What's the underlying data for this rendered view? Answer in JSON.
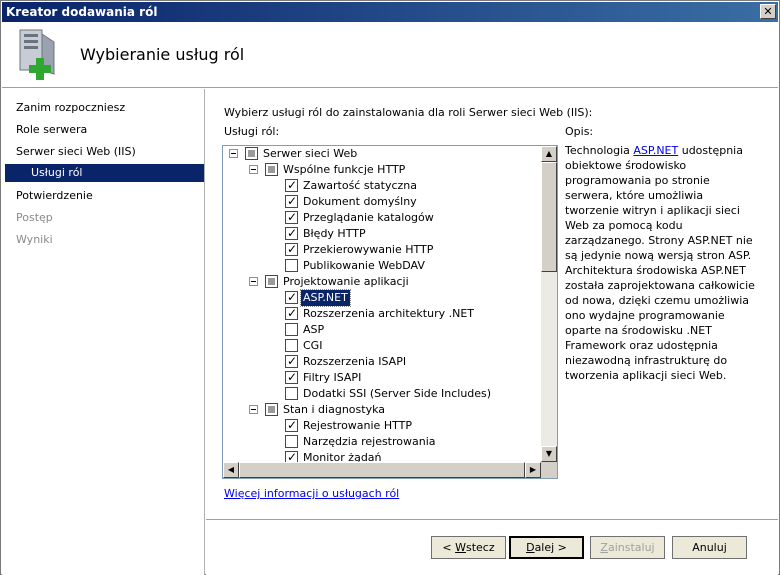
{
  "window": {
    "title": "Kreator dodawania ról",
    "close_glyph": "✕"
  },
  "header": {
    "title": "Wybieranie usług ról",
    "icon": "server-add-icon"
  },
  "nav": {
    "items": [
      {
        "label": "Zanim rozpoczniesz",
        "state": "normal"
      },
      {
        "label": "Role serwera",
        "state": "normal"
      },
      {
        "label": "Serwer sieci Web (IIS)",
        "state": "normal"
      },
      {
        "label": "Usługi ról",
        "state": "selected"
      },
      {
        "label": "Potwierdzenie",
        "state": "normal"
      },
      {
        "label": "Postęp",
        "state": "disabled"
      },
      {
        "label": "Wyniki",
        "state": "disabled"
      }
    ]
  },
  "content": {
    "intro": "Wybierz usługi ról do zainstalowania dla roli Serwer sieci Web (IIS):",
    "services_label": "Usługi ról:",
    "description_label": "Opis:",
    "tree": [
      {
        "label": "Serwer sieci Web",
        "level": 0,
        "expander": true,
        "state": "partial"
      },
      {
        "label": "Wspólne funkcje HTTP",
        "level": 1,
        "expander": true,
        "state": "partial"
      },
      {
        "label": "Zawartość statyczna",
        "level": 2,
        "state": "checked"
      },
      {
        "label": "Dokument domyślny",
        "level": 2,
        "state": "checked"
      },
      {
        "label": "Przeglądanie katalogów",
        "level": 2,
        "state": "checked"
      },
      {
        "label": "Błędy HTTP",
        "level": 2,
        "state": "checked"
      },
      {
        "label": "Przekierowywanie HTTP",
        "level": 2,
        "state": "checked"
      },
      {
        "label": "Publikowanie WebDAV",
        "level": 2,
        "state": "unchecked"
      },
      {
        "label": "Projektowanie aplikacji",
        "level": 1,
        "expander": true,
        "state": "partial"
      },
      {
        "label": "ASP.NET",
        "level": 2,
        "state": "checked",
        "selected": true
      },
      {
        "label": "Rozszerzenia architektury .NET",
        "level": 2,
        "state": "checked"
      },
      {
        "label": "ASP",
        "level": 2,
        "state": "unchecked"
      },
      {
        "label": "CGI",
        "level": 2,
        "state": "unchecked"
      },
      {
        "label": "Rozszerzenia ISAPI",
        "level": 2,
        "state": "checked"
      },
      {
        "label": "Filtry ISAPI",
        "level": 2,
        "state": "checked"
      },
      {
        "label": "Dodatki SSI (Server Side Includes)",
        "level": 2,
        "state": "unchecked"
      },
      {
        "label": "Stan i diagnostyka",
        "level": 1,
        "expander": true,
        "state": "partial"
      },
      {
        "label": "Rejestrowanie HTTP",
        "level": 2,
        "state": "checked"
      },
      {
        "label": "Narzędzia rejestrowania",
        "level": 2,
        "state": "unchecked"
      },
      {
        "label": "Monitor żądań",
        "level": 2,
        "state": "checked"
      }
    ],
    "description": {
      "before": "Technologia ",
      "link": "ASP.NET",
      "after": " udostępnia obiektowe środowisko programowania po stronie serwera, które umożliwia tworzenie witryn i aplikacji sieci Web za pomocą kodu zarządzanego. Strony ASP.NET nie są jedynie nową wersją stron ASP. Architektura środowiska ASP.NET została zaprojektowana całkowicie od nowa, dzięki czemu umożliwia ono wydajne programowanie oparte na środowisku .NET Framework oraz udostępnia niezawodną infrastrukturę do tworzenia aplikacji sieci Web."
    },
    "more_info_link": "Więcej informacji o usługach ról"
  },
  "footer": {
    "back": {
      "prefix": "< ",
      "accel": "W",
      "rest": "stecz"
    },
    "next": {
      "accel": "D",
      "rest": "alej >"
    },
    "install": {
      "accel": "Z",
      "rest": "ainstaluj"
    },
    "cancel": {
      "label": "Anuluj"
    }
  },
  "colors": {
    "accent": "#0a246a",
    "link": "#0000ee"
  }
}
